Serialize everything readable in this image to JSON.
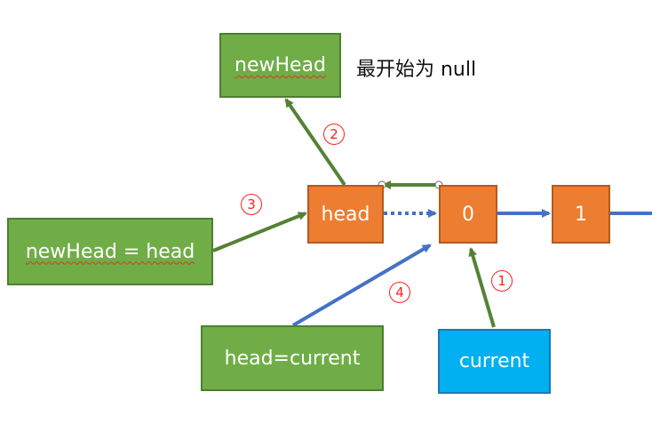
{
  "nodes": {
    "new_head_box": "newHead",
    "assign_new_head": "newHead = head",
    "head_node": "head",
    "zero_node": "0",
    "one_node": "1",
    "assign_head": "head=current",
    "current_box": "current"
  },
  "note_initial_null": "最开始为 null",
  "steps": {
    "step1": "1",
    "step2": "2",
    "step3": "3",
    "step4": "4"
  },
  "colors": {
    "green_fill": "#70ad47",
    "green_arrow": "#548235",
    "orange_fill": "#ed7d31",
    "cyan_fill": "#00b0f0",
    "blue_arrow": "#4472c4",
    "step_red": "#ff1f1f"
  }
}
